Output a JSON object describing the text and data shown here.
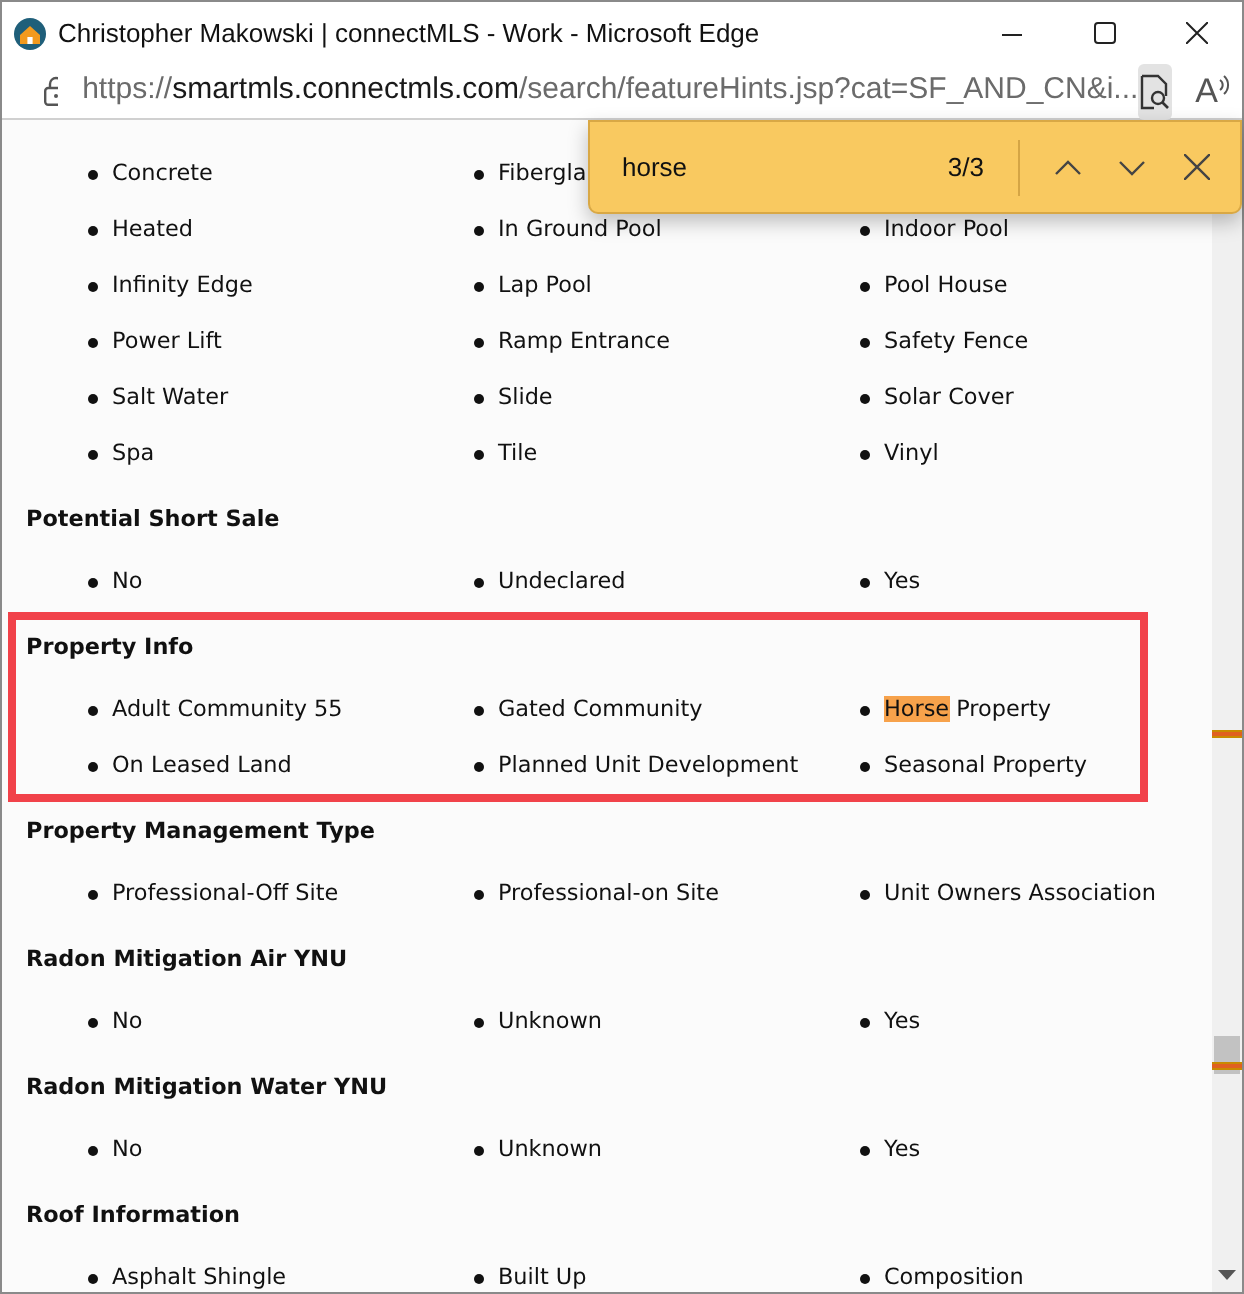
{
  "window": {
    "title": "Christopher Makowski | connectMLS - Work - Microsoft Edge"
  },
  "address_bar": {
    "scheme": "https://",
    "host": "smartmls.connectmls.com",
    "path": "/search/featureHints.jsp?cat=SF_AND_CN&i...",
    "read_aloud_label": "A"
  },
  "find_bar": {
    "query": "horse",
    "count": "3/3"
  },
  "sections": [
    {
      "outlined": false,
      "rows": [
        [
          "Concrete",
          "Fibergla"
        ],
        [
          "Heated",
          "In Ground Pool",
          "Indoor Pool"
        ],
        [
          "Infinity Edge",
          "Lap Pool",
          "Pool House"
        ],
        [
          "Power Lift",
          "Ramp Entrance",
          "Safety Fence"
        ],
        [
          "Salt Water",
          "Slide",
          "Solar Cover"
        ],
        [
          "Spa",
          "Tile",
          "Vinyl"
        ]
      ]
    },
    {
      "heading": "Potential Short Sale",
      "outlined": false,
      "rows": [
        [
          "No",
          "Undeclared",
          "Yes"
        ]
      ]
    },
    {
      "heading": "Property Info",
      "outlined": true,
      "rows": [
        [
          "Adult Community 55",
          "Gated Community",
          {
            "parts": [
              {
                "text": "Horse",
                "highlighted": true
              },
              {
                "text": " Property",
                "highlighted": false
              }
            ]
          }
        ],
        [
          "On Leased Land",
          "Planned Unit Development",
          "Seasonal Property"
        ]
      ]
    },
    {
      "heading": "Property Management Type",
      "outlined": false,
      "rows": [
        [
          "Professional-Off Site",
          "Professional-on Site",
          "Unit Owners Association"
        ]
      ]
    },
    {
      "heading": "Radon Mitigation Air YNU",
      "outlined": false,
      "rows": [
        [
          "No",
          "Unknown",
          "Yes"
        ]
      ]
    },
    {
      "heading": "Radon Mitigation Water YNU",
      "outlined": false,
      "rows": [
        [
          "No",
          "Unknown",
          "Yes"
        ]
      ]
    },
    {
      "heading": "Roof Information",
      "outlined": false,
      "rows": [
        [
          "Asphalt Shingle",
          "Built Up",
          "Composition"
        ]
      ]
    }
  ]
}
